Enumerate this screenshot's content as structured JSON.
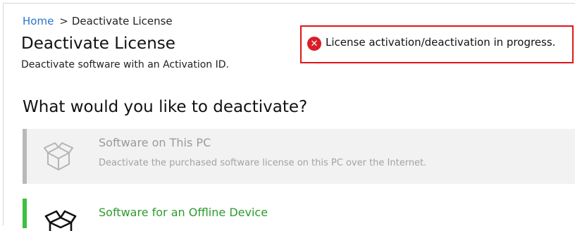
{
  "breadcrumb": {
    "home": "Home",
    "separator": ">",
    "current": "Deactivate License"
  },
  "header": {
    "title": "Deactivate License",
    "subtitle": "Deactivate software with an Activation ID."
  },
  "alert": {
    "icon": "error-icon",
    "icon_glyph": "✕",
    "message": "License activation/deactivation in progress.",
    "border_color": "#e01616"
  },
  "main": {
    "question": "What would you like to deactivate?",
    "options": [
      {
        "title": "Software on This PC",
        "description": "Deactivate the purchased software license on this PC over the Internet.",
        "icon": "package-icon",
        "state": "disabled",
        "accent": "#b9b9b9"
      },
      {
        "title": "Software for an Offline Device",
        "icon": "package-icon",
        "state": "enabled",
        "accent": "#3fbf3f"
      }
    ]
  }
}
